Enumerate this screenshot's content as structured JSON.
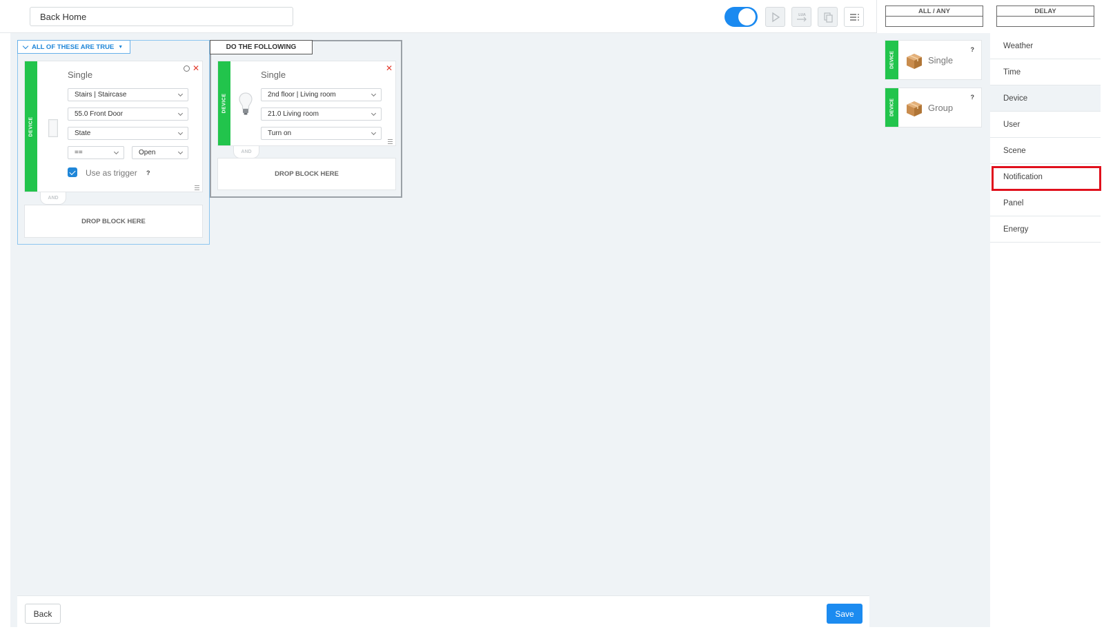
{
  "header": {
    "rule_name": "Back Home",
    "enabled": true
  },
  "condition_group": {
    "label": "ALL OF THESE ARE TRUE",
    "block": {
      "category": "DEVICE",
      "title": "Single",
      "room": "Stairs | Staircase",
      "device": "55.0 Front Door",
      "property": "State",
      "operator": "==",
      "value": "Open",
      "trigger_label": "Use as trigger",
      "trigger_checked": true,
      "help": "?"
    },
    "connector": "AND",
    "drop_label": "DROP BLOCK HERE"
  },
  "action_group": {
    "label": "DO THE FOLLOWING",
    "block": {
      "category": "DEVICE",
      "title": "Single",
      "room": "2nd floor | Living room",
      "device": "21.0 Living room",
      "action": "Turn on"
    },
    "connector": "AND",
    "drop_label": "DROP BLOCK HERE"
  },
  "footer": {
    "back_label": "Back",
    "save_label": "Save"
  },
  "right_panel": {
    "header_left": "ALL / ANY",
    "header_right": "DELAY",
    "palette": [
      {
        "category": "DEVICE",
        "label": "Single",
        "help": "?"
      },
      {
        "category": "DEVICE",
        "label": "Group",
        "help": "?"
      }
    ],
    "categories": [
      "Weather",
      "Time",
      "Device",
      "User",
      "Scene",
      "Notification",
      "Panel",
      "Energy"
    ],
    "selected_category": "Device",
    "highlighted_category": "Notification"
  },
  "colors": {
    "accent": "#1c8bf0",
    "device_green": "#22c44c",
    "close_red": "#e23a2c",
    "highlight_red": "#e0101c"
  }
}
